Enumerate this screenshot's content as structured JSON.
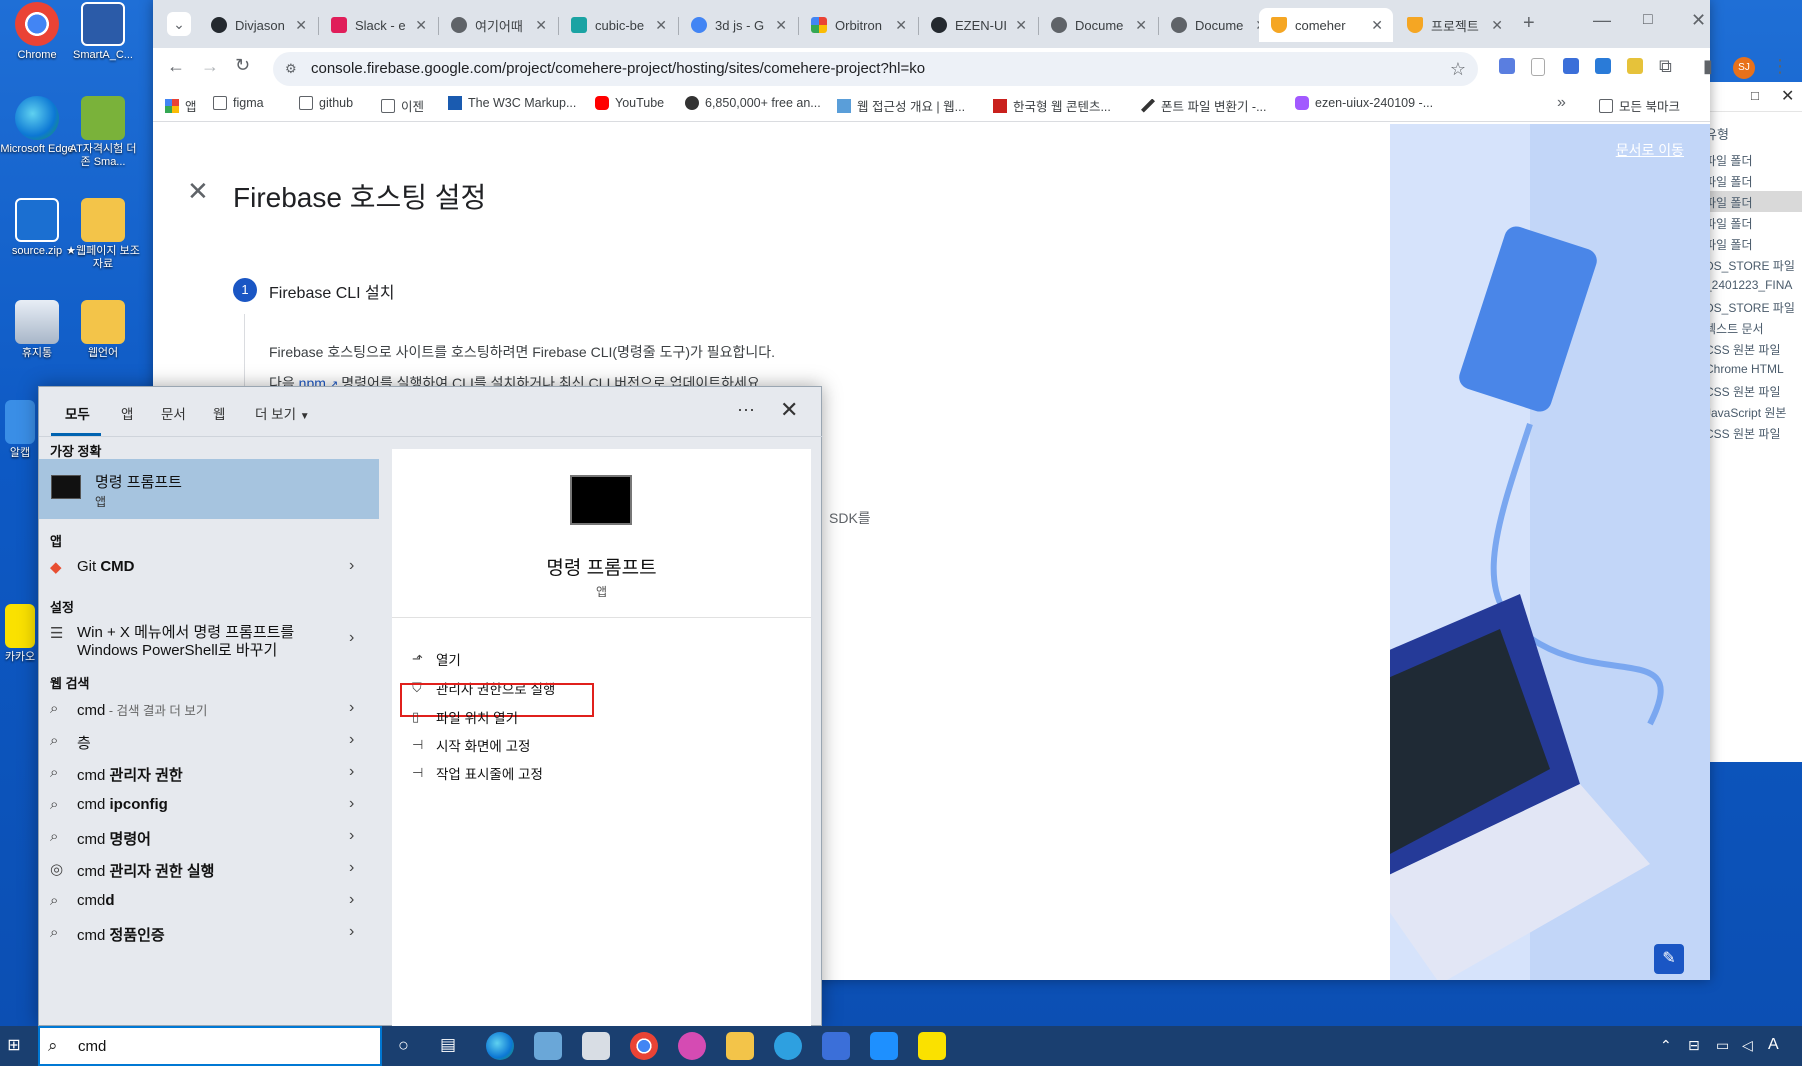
{
  "desktop": {
    "icons": [
      {
        "label": "Chrome"
      },
      {
        "label": "SmartA_C..."
      },
      {
        "label": "Microsoft Edge"
      },
      {
        "label": "AT자격시험 더존 Sma..."
      },
      {
        "label": "source.zip"
      },
      {
        "label": "★웹페이지 보조자료"
      },
      {
        "label": "휴지통"
      },
      {
        "label": "웹언어"
      },
      {
        "label": "알캡"
      },
      {
        "label": "카카오"
      }
    ]
  },
  "explorer": {
    "column_header": "유형",
    "items": [
      "파일 폴더",
      "파일 폴더",
      "파일 폴더",
      "파일 폴더",
      "파일 폴더",
      "DS_STORE 파일",
      "_2401223_FINA",
      "DS_STORE 파일",
      "텍스트 문서",
      "CSS 원본 파일",
      "Chrome HTML",
      "CSS 원본 파일",
      "JavaScript 원본",
      "CSS 원본 파일"
    ],
    "selected_index": 2
  },
  "browser": {
    "tabs": [
      {
        "label": "Divjason",
        "icon_color": "#24292f"
      },
      {
        "label": "Slack - e",
        "icon_color": "#e01e5a"
      },
      {
        "label": "여기어때",
        "icon_color": "#5f6368"
      },
      {
        "label": "cubic-be",
        "icon_color": "#1aa3a3"
      },
      {
        "label": "3d js - G",
        "icon_color": "#4285f4"
      },
      {
        "label": "Orbitron",
        "icon_color": "#ea4335"
      },
      {
        "label": "EZEN-UI",
        "icon_color": "#24292f"
      },
      {
        "label": "Docume",
        "icon_color": "#5f6368"
      },
      {
        "label": "Docume",
        "icon_color": "#5f6368"
      },
      {
        "label": "comeher",
        "icon_color": "#f5a623"
      },
      {
        "label": "프로젝트",
        "icon_color": "#f5a623"
      }
    ],
    "active_tab_index": 9,
    "url": "console.firebase.google.com/project/comehere-project/hosting/sites/comehere-project?hl=ko",
    "profile_initials": "SJ",
    "bookmarks": [
      {
        "label": "앱"
      },
      {
        "label": "figma"
      },
      {
        "label": "github"
      },
      {
        "label": "이젠"
      },
      {
        "label": "The W3C Markup..."
      },
      {
        "label": "YouTube"
      },
      {
        "label": "6,850,000+ free an..."
      },
      {
        "label": "웹 접근성 개요 | 웹..."
      },
      {
        "label": "한국형 웹 콘텐츠..."
      },
      {
        "label": "폰트 파일 변환기 -..."
      },
      {
        "label": "ezen-uiux-240109 -..."
      }
    ],
    "all_bookmarks": "모든 북마크"
  },
  "firebase": {
    "title": "Firebase 호스팅 설정",
    "docs_link": "문서로 이동",
    "step_number": "1",
    "step_title": "Firebase CLI 설치",
    "desc1": "Firebase 호스팅으로 사이트를 호스팅하려면 Firebase CLI(명령줄 도구)가 필요합니다.",
    "desc2_pre": "다음",
    "desc2_link": "npm",
    "desc2_post": "명령어를 실행하여 CLI를 설치하거나 최신 CLI 버전으로 업데이트하세요.",
    "sdk_fragment": "SDK를"
  },
  "search_panel": {
    "tabs": [
      "모두",
      "앱",
      "문서",
      "웹",
      "더 보기"
    ],
    "active_tab": "모두",
    "best_match_header": "가장 정확",
    "best_match": {
      "title": "명령 프롬프트",
      "subtitle": "앱"
    },
    "apps_header": "앱",
    "apps": [
      {
        "prefix": "Git ",
        "bold": "CMD"
      }
    ],
    "settings_header": "설정",
    "settings": [
      {
        "line1": "Win + X 메뉴에서 명령 프롬프트를",
        "line2": "Windows PowerShell로 바꾸기"
      }
    ],
    "web_header": "웹 검색",
    "web_results": [
      {
        "text": "cmd",
        "suffix": " - 검색 결과 더 보기",
        "bold": ""
      },
      {
        "text": "층",
        "suffix": "",
        "bold": ""
      },
      {
        "text": "cmd ",
        "suffix": "",
        "bold": "관리자 권한"
      },
      {
        "text": "cmd ",
        "suffix": "",
        "bold": "ipconfig"
      },
      {
        "text": "cmd ",
        "suffix": "",
        "bold": "명령어"
      },
      {
        "text": "cmd ",
        "suffix": "",
        "bold": "관리자 권한 실행"
      },
      {
        "text": "cmd",
        "suffix": "",
        "bold": "d"
      },
      {
        "text": "cmd ",
        "suffix": "",
        "bold": "정품인증"
      }
    ],
    "preview": {
      "title": "명령 프롬프트",
      "subtitle": "앱",
      "actions": [
        "열기",
        "관리자 권한으로 실행",
        "파일 위치 열기",
        "시작 화면에 고정",
        "작업 표시줄에 고정"
      ],
      "highlighted_action_index": 1
    }
  },
  "taskbar": {
    "search_value": "cmd",
    "tray_text": "A"
  }
}
